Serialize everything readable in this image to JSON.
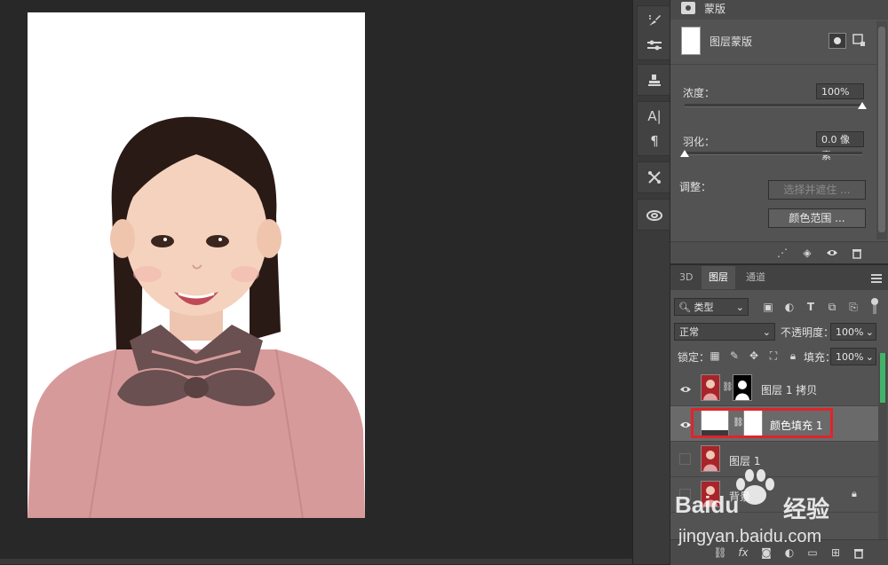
{
  "properties": {
    "header_label": "蒙版",
    "mask_label": "图层蒙版",
    "density_label": "浓度：",
    "density_value": "100%",
    "density_level": 1.0,
    "feather_label": "羽化：",
    "feather_value": "0.0 像素",
    "feather_level": 0.0,
    "adjust_label": "调整：",
    "select_mask_button": "选择并遮住 ...",
    "color_range_button": "颜色范围 ..."
  },
  "tabs": [
    "3D",
    "图层",
    "通道"
  ],
  "layers_panel": {
    "filter_kind": "类型",
    "blend_mode": "正常",
    "opacity_label": "不透明度：",
    "opacity_value": "100%",
    "lock_label": "锁定：",
    "fill_label": "填充：",
    "fill_value": "100%",
    "layers": [
      {
        "name": "图层 1 拷贝",
        "visible": true
      },
      {
        "name": "颜色填充 1",
        "visible": true,
        "selected": true,
        "highlighted": true
      },
      {
        "name": "图层 1",
        "visible": false
      },
      {
        "name": "背景",
        "visible": false,
        "locked": true
      }
    ]
  },
  "watermark": {
    "brand": "Baidu",
    "brand_cn": "经验",
    "url": "jingyan.baidu.com"
  },
  "colors": {
    "panel_bg": "#535353",
    "canvas_bg": "#282828",
    "highlight_border": "#e0242a",
    "sweater_pink": "#d79a9b",
    "bow_brown": "#6a5050"
  }
}
